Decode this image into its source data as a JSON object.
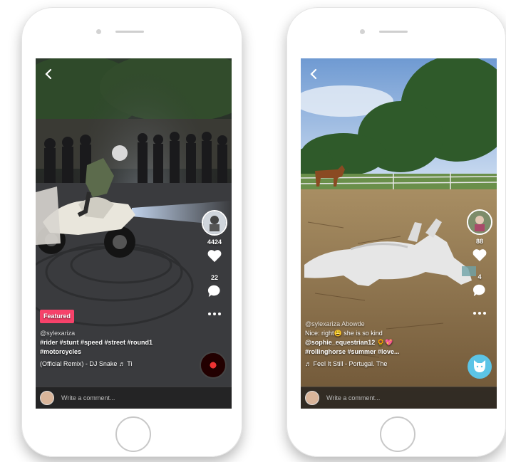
{
  "left": {
    "likes_count": "4424",
    "comments_count": "22",
    "badge": "Featured",
    "username": "@sylexariza",
    "hashtags_line1": "#rider #stunt #speed #street #round1",
    "hashtags_line2": "#motorcycles",
    "music": "(Official Remix) - DJ Snake ♬ Ti",
    "comment_placeholder": "Write a comment..."
  },
  "right": {
    "likes_count": "88",
    "comments_count": "4",
    "username": "@sylexariza Abowde",
    "caption_line1": "Nice: right😩 she is so kind",
    "caption_line2": "@sophie_equestrian12 🌻💖",
    "caption_line3": "#rollinghorse #summer #love...",
    "music": "♬ Feel It Still - Portugal. The",
    "comment_placeholder": "Write a comment..."
  },
  "colors": {
    "badge": "#f7426a",
    "cat_button": "#5cc4e6"
  },
  "icons": [
    "back-chevron-icon",
    "heart-icon",
    "comment-bubble-icon",
    "more-dots-icon",
    "music-note-icon",
    "cat-face-icon"
  ]
}
